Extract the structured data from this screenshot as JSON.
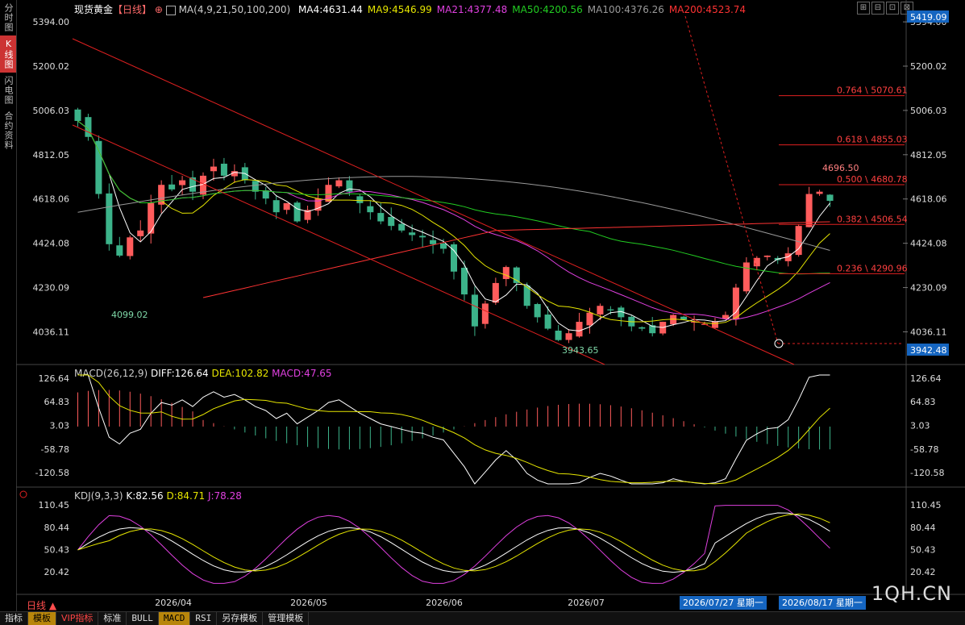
{
  "sidebar": {
    "tabs": [
      {
        "label": "分时图",
        "active": false
      },
      {
        "label": "K线图",
        "active": true
      },
      {
        "label": "闪电图",
        "active": false
      },
      {
        "label": "合约资料",
        "active": false
      }
    ]
  },
  "header": {
    "symbol": "现货黄金",
    "period": "【日线】",
    "indicator_name": "MA(4,9,21,50,100,200)",
    "ma_values": [
      {
        "label": "MA4:4631.44",
        "color": "#ffffff"
      },
      {
        "label": "MA9:4546.99",
        "color": "#e5e500"
      },
      {
        "label": "MA21:4377.48",
        "color": "#e040e0"
      },
      {
        "label": "MA50:4200.56",
        "color": "#22cc22"
      },
      {
        "label": "MA100:4376.26",
        "color": "#999999"
      },
      {
        "label": "MA200:4523.74",
        "color": "#ff3333"
      }
    ]
  },
  "macd_header": {
    "name": "MACD(26,12,9)",
    "diff": "DIFF:126.64",
    "dea": "DEA:102.82",
    "macd": "MACD:47.65"
  },
  "kdj_header": {
    "name": "KDJ(9,3,3)",
    "k": "K:82.56",
    "d": "D:84.71",
    "j": "J:78.28"
  },
  "price_axis": {
    "ticks": [
      "5394.00",
      "5200.02",
      "5006.03",
      "4812.05",
      "4618.06",
      "4424.08",
      "4230.09",
      "4036.11"
    ],
    "top_label": "5419.09",
    "cursor_label": "3942.48"
  },
  "macd_axis": {
    "ticks": [
      "126.64",
      "64.83",
      "3.03",
      "-58.78",
      "-120.58"
    ]
  },
  "kdj_axis": {
    "ticks": [
      "110.45",
      "80.44",
      "50.43",
      "20.42"
    ]
  },
  "x_axis": {
    "ticks": [
      "2026/04",
      "2026/05",
      "2026/06",
      "2026/07"
    ]
  },
  "annotations": {
    "high_label": "4099.02",
    "low_label": "3943.65",
    "recent_high_label": "4696.50",
    "fib_levels": [
      "0.764 \\ 5070.61",
      "0.618 \\ 4855.03",
      "0.500 \\ 4680.78",
      "0.382 \\ 4506.54",
      "0.236 \\ 4290.96"
    ]
  },
  "date_boxes": [
    "2026/07/27 星期一",
    "2026/08/17 星期一"
  ],
  "bottom_period_label": "日线 ▲",
  "toolbar": {
    "items": [
      "指标",
      "模板",
      "VIP指标",
      "标准",
      "BULL",
      "MACD",
      "RSI",
      "另存模板",
      "管理模板"
    ]
  },
  "watermark": "1QH.CN",
  "window_buttons": [
    "⊞",
    "⊟",
    "⊡",
    "⊠"
  ],
  "colors": {
    "up": "#ff5c5c",
    "down": "#3cb38a",
    "ma4": "#ffffff",
    "ma9": "#e5e500",
    "ma21": "#e040e0",
    "ma50": "#22cc22",
    "ma100": "#999999",
    "ma200": "#ff3333"
  },
  "chart_data": {
    "type": "candlestick",
    "title": "现货黄金【日线】",
    "x": [
      "2026/04",
      "2026/05",
      "2026/06",
      "2026/07"
    ],
    "ylim": [
      3900,
      5419.09
    ],
    "closes": [
      4960,
      4890,
      4640,
      4420,
      4370,
      4450,
      4480,
      4600,
      4680,
      4660,
      4700,
      4650,
      4720,
      4760,
      4720,
      4740,
      4700,
      4650,
      4620,
      4560,
      4600,
      4520,
      4570,
      4620,
      4680,
      4700,
      4650,
      4600,
      4560,
      4520,
      4500,
      4480,
      4460,
      4450,
      4420,
      4400,
      4300,
      4200,
      4060,
      4160,
      4250,
      4320,
      4250,
      4150,
      4100,
      4050,
      4000,
      4030,
      4080,
      4120,
      4150,
      4130,
      4100,
      4060,
      4050,
      4030,
      4080,
      4110,
      4090,
      4080,
      4070,
      4080,
      4110,
      4230,
      4340,
      4360,
      4370,
      4350,
      4380,
      4500,
      4640,
      4650,
      4610
    ]
  }
}
